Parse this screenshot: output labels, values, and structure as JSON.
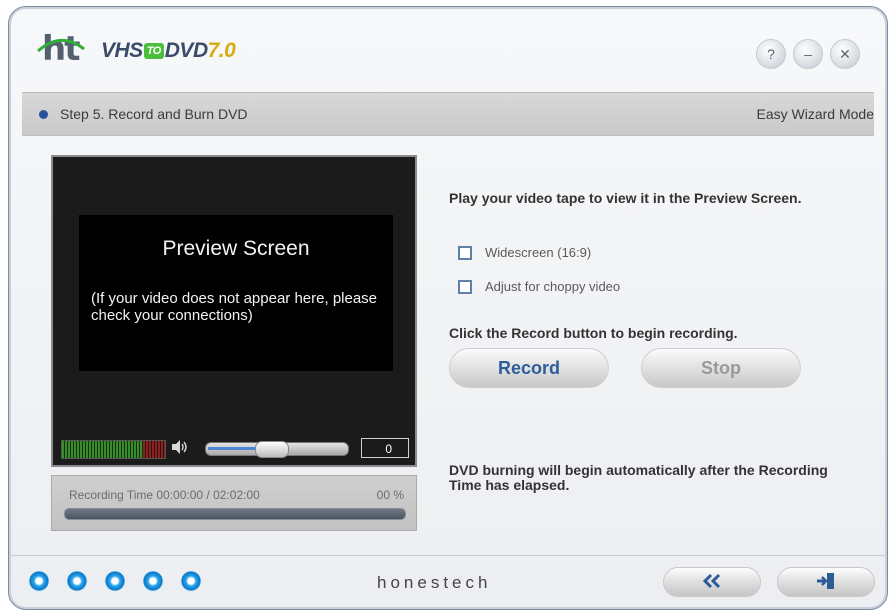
{
  "app": {
    "logo_mark": "ht",
    "name_prefix": "VHS",
    "name_to": "TO",
    "name_suffix": "DVD",
    "version": "7.0"
  },
  "window_controls": {
    "help_label": "?",
    "minimize_label": "–",
    "close_label": "✕"
  },
  "stepbar": {
    "step_text": "Step 5. Record and Burn DVD",
    "mode_text": "Easy Wizard Mode"
  },
  "preview": {
    "title": "Preview Screen",
    "message": "(If your video does not appear here, please check your connections)",
    "counter_value": "0",
    "volume_level": 0.45,
    "speaker_icon": "speaker-icon",
    "vu_meter_icon": "vu-meter-icon"
  },
  "recording": {
    "label": "Recording Time  00:00:00 / 02:02:00",
    "percent": "00 %",
    "progress": 0
  },
  "instructions": {
    "play_text": "Play your video tape to view it in the Preview Screen.",
    "widescreen_label": "Widescreen (16:9)",
    "choppy_label": "Adjust for choppy video",
    "record_text": "Click the Record button to begin recording.",
    "burn_text": "DVD burning will begin automatically after the Recording Time has elapsed."
  },
  "buttons": {
    "record": "Record",
    "stop": "Stop",
    "back_icon": "double-chevron-left-icon",
    "exit_icon": "exit-door-icon"
  },
  "footer": {
    "brand": "honestech",
    "step_dots": [
      1,
      2,
      3,
      4,
      5
    ]
  },
  "colors": {
    "accent_blue": "#2d5f9a",
    "stop_gray": "#9a9a9a",
    "dot_blue": "#1a8ee0",
    "logo_green": "#4bbf3c",
    "version_gold": "#d7aa10"
  }
}
